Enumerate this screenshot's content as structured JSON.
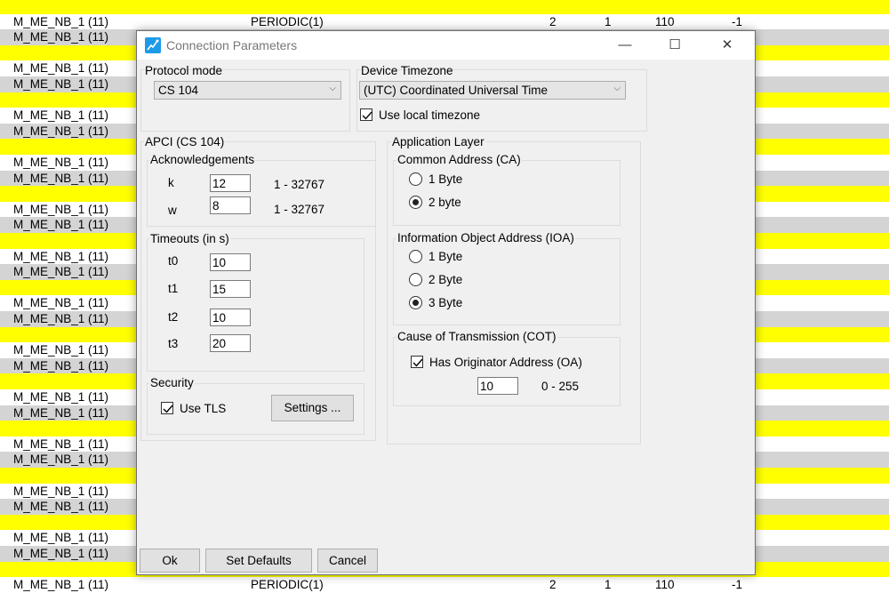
{
  "background_table": {
    "rows": [
      {
        "name": "",
        "type": "",
        "v1": "",
        "v2": "",
        "v3": "",
        "v4": "",
        "color": "yellow"
      },
      {
        "name": "M_ME_NB_1 (11)",
        "type": "PERIODIC(1)",
        "v1": "2",
        "v2": "1",
        "v3": "110",
        "v4": "-1",
        "color": "white"
      },
      {
        "name": "M_ME_NB_1 (11)",
        "type": "",
        "v1": "",
        "v2": "",
        "v3": "",
        "v4": "",
        "color": "gray"
      },
      {
        "name": "",
        "type": "",
        "v1": "",
        "v2": "",
        "v3": "",
        "v4": "",
        "color": "yellow"
      },
      {
        "name": "M_ME_NB_1 (11)",
        "type": "",
        "v1": "",
        "v2": "",
        "v3": "",
        "v4": "",
        "color": "white"
      },
      {
        "name": "M_ME_NB_1 (11)",
        "type": "",
        "v1": "",
        "v2": "",
        "v3": "",
        "v4": "",
        "color": "gray"
      },
      {
        "name": "",
        "type": "",
        "v1": "",
        "v2": "",
        "v3": "",
        "v4": "",
        "color": "yellow"
      },
      {
        "name": "M_ME_NB_1 (11)",
        "type": "",
        "v1": "",
        "v2": "",
        "v3": "",
        "v4": "",
        "color": "white"
      },
      {
        "name": "M_ME_NB_1 (11)",
        "type": "",
        "v1": "",
        "v2": "",
        "v3": "",
        "v4": "",
        "color": "gray"
      },
      {
        "name": "",
        "type": "",
        "v1": "",
        "v2": "",
        "v3": "",
        "v4": "",
        "color": "yellow"
      },
      {
        "name": "M_ME_NB_1 (11)",
        "type": "",
        "v1": "",
        "v2": "",
        "v3": "",
        "v4": "",
        "color": "white"
      },
      {
        "name": "M_ME_NB_1 (11)",
        "type": "",
        "v1": "",
        "v2": "",
        "v3": "",
        "v4": "",
        "color": "gray"
      },
      {
        "name": "",
        "type": "",
        "v1": "",
        "v2": "",
        "v3": "",
        "v4": "",
        "color": "yellow"
      },
      {
        "name": "M_ME_NB_1 (11)",
        "type": "",
        "v1": "",
        "v2": "",
        "v3": "",
        "v4": "",
        "color": "white"
      },
      {
        "name": "M_ME_NB_1 (11)",
        "type": "",
        "v1": "",
        "v2": "",
        "v3": "",
        "v4": "",
        "color": "gray"
      },
      {
        "name": "",
        "type": "",
        "v1": "",
        "v2": "",
        "v3": "",
        "v4": "",
        "color": "yellow"
      },
      {
        "name": "M_ME_NB_1 (11)",
        "type": "",
        "v1": "",
        "v2": "",
        "v3": "",
        "v4": "",
        "color": "white"
      },
      {
        "name": "M_ME_NB_1 (11)",
        "type": "",
        "v1": "",
        "v2": "",
        "v3": "",
        "v4": "",
        "color": "gray"
      },
      {
        "name": "",
        "type": "",
        "v1": "",
        "v2": "",
        "v3": "",
        "v4": "",
        "color": "yellow"
      },
      {
        "name": "M_ME_NB_1 (11)",
        "type": "",
        "v1": "",
        "v2": "",
        "v3": "",
        "v4": "",
        "color": "white"
      },
      {
        "name": "M_ME_NB_1 (11)",
        "type": "",
        "v1": "",
        "v2": "",
        "v3": "",
        "v4": "",
        "color": "gray"
      },
      {
        "name": "",
        "type": "",
        "v1": "",
        "v2": "",
        "v3": "",
        "v4": "",
        "color": "yellow"
      },
      {
        "name": "M_ME_NB_1 (11)",
        "type": "",
        "v1": "",
        "v2": "",
        "v3": "",
        "v4": "",
        "color": "white"
      },
      {
        "name": "M_ME_NB_1 (11)",
        "type": "",
        "v1": "",
        "v2": "",
        "v3": "",
        "v4": "",
        "color": "gray"
      },
      {
        "name": "",
        "type": "",
        "v1": "",
        "v2": "",
        "v3": "",
        "v4": "",
        "color": "yellow"
      },
      {
        "name": "M_ME_NB_1 (11)",
        "type": "",
        "v1": "",
        "v2": "",
        "v3": "",
        "v4": "",
        "color": "white"
      },
      {
        "name": "M_ME_NB_1 (11)",
        "type": "",
        "v1": "",
        "v2": "",
        "v3": "",
        "v4": "",
        "color": "gray"
      },
      {
        "name": "",
        "type": "",
        "v1": "",
        "v2": "",
        "v3": "",
        "v4": "",
        "color": "yellow"
      },
      {
        "name": "M_ME_NB_1 (11)",
        "type": "",
        "v1": "",
        "v2": "",
        "v3": "",
        "v4": "",
        "color": "white"
      },
      {
        "name": "M_ME_NB_1 (11)",
        "type": "",
        "v1": "",
        "v2": "",
        "v3": "",
        "v4": "",
        "color": "gray"
      },
      {
        "name": "",
        "type": "",
        "v1": "",
        "v2": "",
        "v3": "",
        "v4": "",
        "color": "yellow"
      },
      {
        "name": "M_ME_NB_1 (11)",
        "type": "",
        "v1": "",
        "v2": "",
        "v3": "",
        "v4": "",
        "color": "white"
      },
      {
        "name": "M_ME_NB_1 (11)",
        "type": "",
        "v1": "",
        "v2": "",
        "v3": "",
        "v4": "",
        "color": "gray"
      },
      {
        "name": "",
        "type": "",
        "v1": "",
        "v2": "",
        "v3": "",
        "v4": "",
        "color": "yellow"
      },
      {
        "name": "M_ME_NB_1 (11)",
        "type": "",
        "v1": "",
        "v2": "",
        "v3": "",
        "v4": "",
        "color": "white"
      },
      {
        "name": "M_ME_NB_1 (11)",
        "type": "",
        "v1": "",
        "v2": "",
        "v3": "",
        "v4": "",
        "color": "gray"
      },
      {
        "name": "",
        "type": "",
        "v1": "",
        "v2": "",
        "v3": "",
        "v4": "",
        "color": "yellow"
      },
      {
        "name": "M_ME_NB_1 (11)",
        "type": "PERIODIC(1)",
        "v1": "2",
        "v2": "1",
        "v3": "110",
        "v4": "-1",
        "color": "white"
      }
    ]
  },
  "dialog": {
    "title": "Connection Parameters",
    "icon": "app-icon",
    "window_controls": {
      "minimize": "—",
      "maximize": "☐",
      "close": "✕"
    },
    "protocol_mode": {
      "label": "Protocol mode",
      "value": "CS 104"
    },
    "device_timezone": {
      "label": "Device Timezone",
      "value": "(UTC) Coordinated Universal Time",
      "use_local_label": "Use local timezone",
      "use_local_checked": true
    },
    "apci": {
      "title": "APCI (CS 104)",
      "acknowledgements": {
        "title": "Acknowledgements",
        "k": {
          "label": "k",
          "value": "12",
          "range": "1 - 32767"
        },
        "w": {
          "label": "w",
          "value": "8",
          "range": "1 - 32767"
        }
      },
      "timeouts": {
        "title": "Timeouts (in s)",
        "t0": {
          "label": "t0",
          "value": "10"
        },
        "t1": {
          "label": "t1",
          "value": "15"
        },
        "t2": {
          "label": "t2",
          "value": "10"
        },
        "t3": {
          "label": "t3",
          "value": "20"
        }
      },
      "security": {
        "title": "Security",
        "use_tls_label": "Use TLS",
        "use_tls_checked": true,
        "settings_button": "Settings ..."
      }
    },
    "application_layer": {
      "title": "Application Layer",
      "common_address": {
        "title": "Common Address (CA)",
        "options": [
          "1 Byte",
          "2 byte"
        ],
        "selected": "2 byte"
      },
      "ioa": {
        "title": "Information Object Address (IOA)",
        "options": [
          "1 Byte",
          "2 Byte",
          "3 Byte"
        ],
        "selected": "3 Byte"
      },
      "cot": {
        "title": "Cause of Transmission (COT)",
        "has_oa_label": "Has Originator Address (OA)",
        "has_oa_checked": true,
        "oa_value": "10",
        "oa_range": "0 - 255"
      }
    },
    "buttons": {
      "ok": "Ok",
      "set_defaults": "Set Defaults",
      "cancel": "Cancel"
    }
  },
  "colors": {
    "row_yellow": "#ffff00",
    "row_gray": "#d4d4d4",
    "dialog_bg": "#f0f0f0",
    "icon_blue": "#1e9be8"
  }
}
